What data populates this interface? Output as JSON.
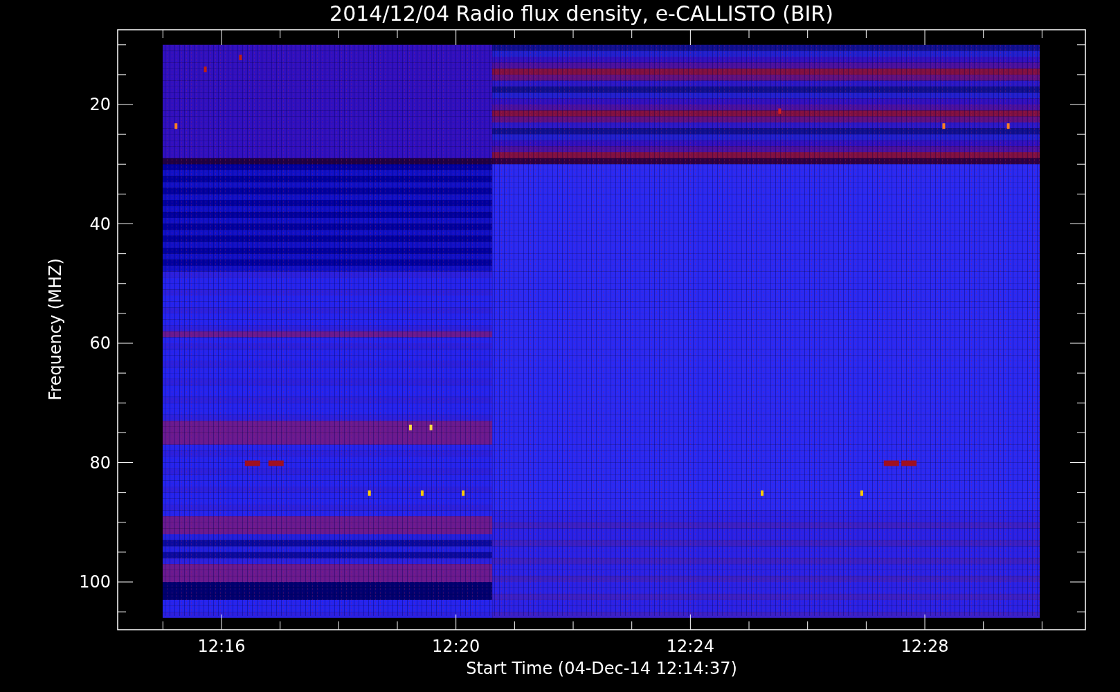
{
  "title": "2014/12/04  Radio flux density, e-CALLISTO (BIR)",
  "y_axis": {
    "label": "Frequency (MHZ)",
    "ticks": [
      "20",
      "40",
      "60",
      "80",
      "100"
    ]
  },
  "x_axis": {
    "label": "Start Time (04-Dec-14 12:14:37)",
    "ticks": [
      "12:16",
      "12:20",
      "12:24",
      "12:28"
    ]
  }
}
